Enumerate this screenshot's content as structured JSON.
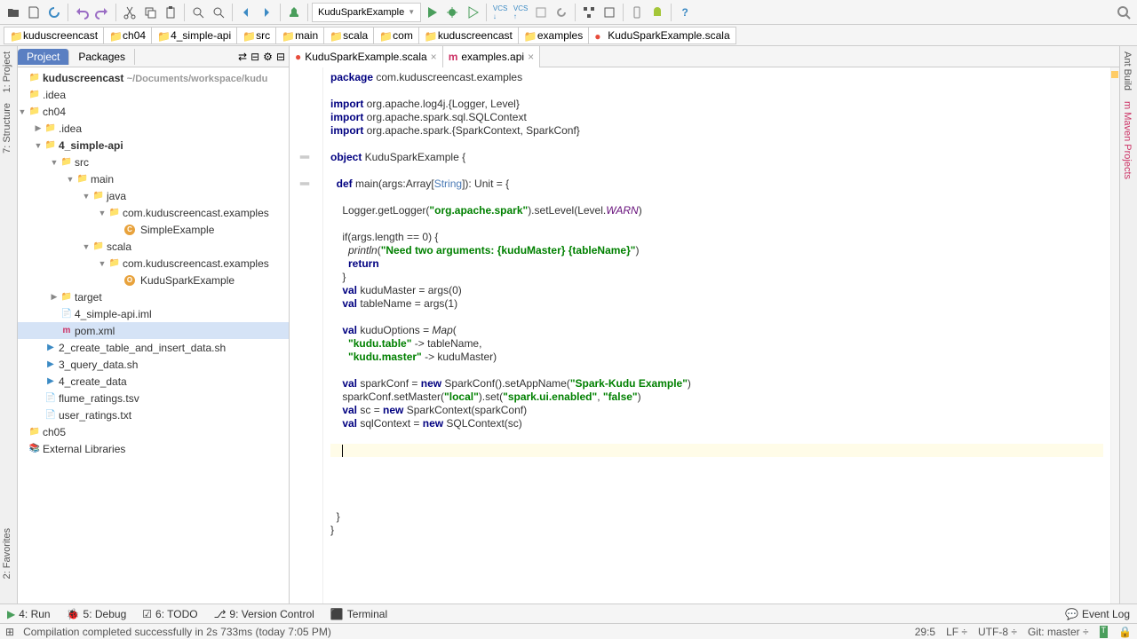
{
  "toolbar": {
    "run_config": "KuduSparkExample"
  },
  "breadcrumb": [
    "kuduscreencast",
    "ch04",
    "4_simple-api",
    "src",
    "main",
    "scala",
    "com",
    "kuduscreencast",
    "examples",
    "KuduSparkExample.scala"
  ],
  "project": {
    "tabs": {
      "project": "Project",
      "packages": "Packages"
    },
    "root": {
      "name": "kuduscreencast",
      "hint": "~/Documents/workspace/kudu"
    },
    "tree": {
      "idea1": ".idea",
      "ch04": "ch04",
      "idea2": ".idea",
      "simpleapi": "4_simple-api",
      "src": "src",
      "main": "main",
      "java": "java",
      "pkg1": "com.kuduscreencast.examples",
      "cls1": "SimpleExample",
      "scala": "scala",
      "pkg2": "com.kuduscreencast.examples",
      "cls2": "KuduSparkExample",
      "target": "target",
      "iml": "4_simple-api.iml",
      "pom": "pom.xml",
      "sh1": "2_create_table_and_insert_data.sh",
      "sh2": "3_query_data.sh",
      "dir4": "4_create_data",
      "tsv": "flume_ratings.tsv",
      "txt": "user_ratings.txt",
      "ch05": "ch05",
      "ext": "External Libraries"
    }
  },
  "editor": {
    "tabs": {
      "t1": "KuduSparkExample.scala",
      "t2": "examples.api"
    },
    "code": {
      "l1a": "package",
      "l1b": " com.kuduscreencast.examples",
      "l3a": "import",
      "l3b": " org.apache.log4j.{Logger, Level}",
      "l4a": "import",
      "l4b": " org.apache.spark.sql.SQLContext",
      "l5a": "import",
      "l5b": " org.apache.spark.{SparkContext, SparkConf}",
      "l7a": "object",
      "l7b": " KuduSparkExample {",
      "l9a": "  def",
      "l9b": " main(args:Array[",
      "l9c": "String",
      "l9d": "]): Unit = {",
      "l11a": "    Logger.getLogger(",
      "l11b": "\"org.apache.spark\"",
      "l11c": ").setLevel(Level.",
      "l11d": "WARN",
      "l11e": ")",
      "l13a": "    if(args.length == 0) {",
      "l14a": "      println",
      "l14b": "(",
      "l14c": "\"Need two arguments: {kuduMaster} {tableName}\"",
      "l14d": ")",
      "l15a": "      return",
      "l16a": "    }",
      "l17a": "    val",
      "l17b": " kuduMaster = args(0)",
      "l18a": "    val",
      "l18b": " tableName = args(1)",
      "l20a": "    val",
      "l20b": " kuduOptions = ",
      "l20c": "Map",
      "l20d": "(",
      "l21a": "      ",
      "l21b": "\"kudu.table\"",
      "l21c": " -> tableName,",
      "l22a": "      ",
      "l22b": "\"kudu.master\"",
      "l22c": " -> kuduMaster)",
      "l24a": "    val",
      "l24b": " sparkConf = ",
      "l24c": "new",
      "l24d": " SparkConf().setAppName(",
      "l24e": "\"Spark-Kudu Example\"",
      "l24f": ")",
      "l25a": "    sparkConf.setMaster(",
      "l25b": "\"local\"",
      "l25c": ").set(",
      "l25d": "\"spark.ui.enabled\"",
      "l25e": ", ",
      "l25f": "\"false\"",
      "l25g": ")",
      "l26a": "    val",
      "l26b": " sc = ",
      "l26c": "new",
      "l26d": " SparkContext(sparkConf)",
      "l27a": "    val",
      "l27b": " sqlContext = ",
      "l27c": "new",
      "l27d": " SQLContext(sc)",
      "l35a": "  }",
      "l36a": "}"
    }
  },
  "bottom": {
    "run": "4: Run",
    "debug": "5: Debug",
    "todo": "6: TODO",
    "vcs": "9: Version Control",
    "terminal": "Terminal",
    "eventlog": "Event Log"
  },
  "status": {
    "msg": "Compilation completed successfully in 2s 733ms (today 7:05 PM)",
    "pos": "29:5",
    "lf": "LF",
    "enc": "UTF-8",
    "git": "Git: master"
  }
}
